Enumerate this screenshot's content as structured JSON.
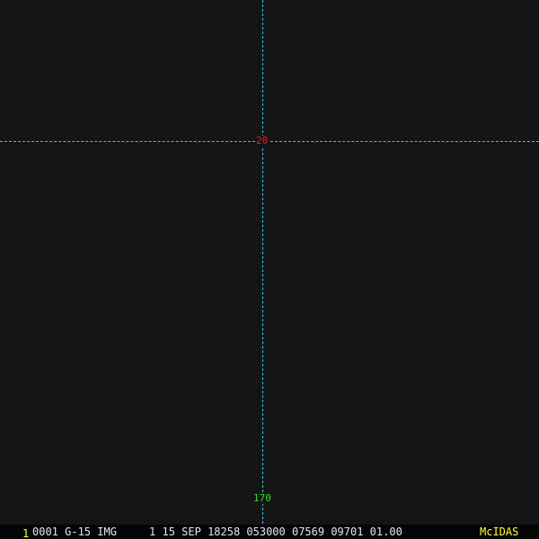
{
  "overlay": {
    "latitude_label": "20",
    "longitude_label": "170",
    "grid_color": "#2fc8d8",
    "latitude_label_color": "#e02020",
    "longitude_label_color": "#30e030"
  },
  "status_bar": {
    "frame_number": "1",
    "text": "0001 G-15 IMG     1 15 SEP 18258 053000 07569 09701 01.00",
    "brand": "McIDAS",
    "text_color": "#e6e6e6",
    "frame_number_color": "#ffff33",
    "brand_color": "#ffff33"
  }
}
